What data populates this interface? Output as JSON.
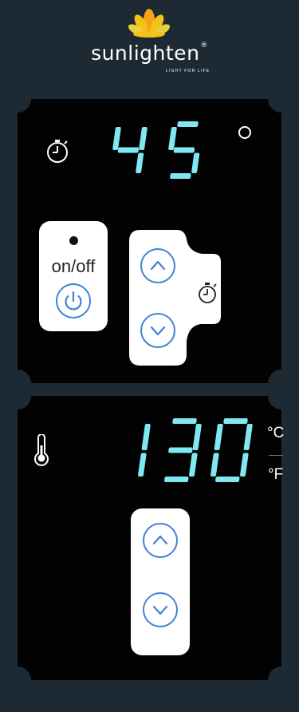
{
  "brand": {
    "name": "sunlighten",
    "trademark": "®",
    "tagline": "LIGHT FOR LIFE",
    "flower_colors": [
      "#f2c418",
      "#f7a21b",
      "#e8d23b"
    ]
  },
  "timer_panel": {
    "icon": "stopwatch-icon",
    "display_value": "45",
    "unit_symbol": "o",
    "power_card": {
      "indicator": "on",
      "label": "on/off",
      "button_icon": "power-icon"
    },
    "adjust": {
      "up_icon": "chevron-up-icon",
      "down_icon": "chevron-down-icon",
      "card_icon": "stopwatch-icon"
    }
  },
  "temp_panel": {
    "icon": "thermometer-icon",
    "display_value": "130",
    "unit_c": "°C",
    "unit_f": "°F",
    "adjust": {
      "up_icon": "chevron-up-icon",
      "down_icon": "chevron-down-icon"
    }
  },
  "colors": {
    "background": "#1d2a33",
    "panel": "#020202",
    "digit": "#7fe8f2",
    "button_ring": "#3f83d4"
  }
}
